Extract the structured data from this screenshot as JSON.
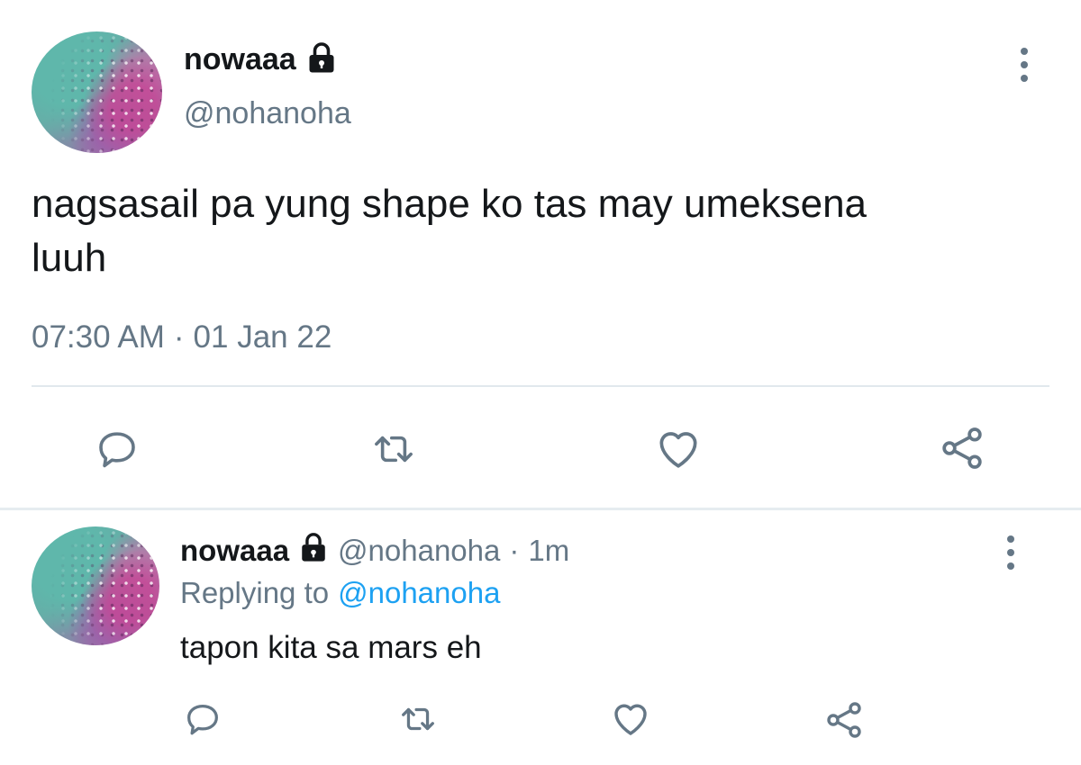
{
  "main_tweet": {
    "display_name": "nowaaa",
    "handle": "@nohanoha",
    "text_line1": "nagsasail pa yung shape ko tas may umeksena",
    "text_line2": "luuh",
    "time": "07:30 AM",
    "separator": "·",
    "date": "01 Jan 22"
  },
  "reply": {
    "display_name": "nowaaa",
    "handle": "@nohanoha",
    "separator": "·",
    "age": "1m",
    "replying_to_label": "Replying to",
    "replying_to_handle": "@nohanoha",
    "text": "tapon kita sa mars eh"
  },
  "icons": {
    "lock": "lock-icon",
    "more": "more-vertical-icon",
    "reply": "reply-icon",
    "retweet": "retweet-icon",
    "like": "heart-icon",
    "share": "share-icon"
  },
  "colors": {
    "text": "#14171a",
    "muted": "#657786",
    "link": "#1da1f2",
    "divider": "#e1e8ed"
  }
}
